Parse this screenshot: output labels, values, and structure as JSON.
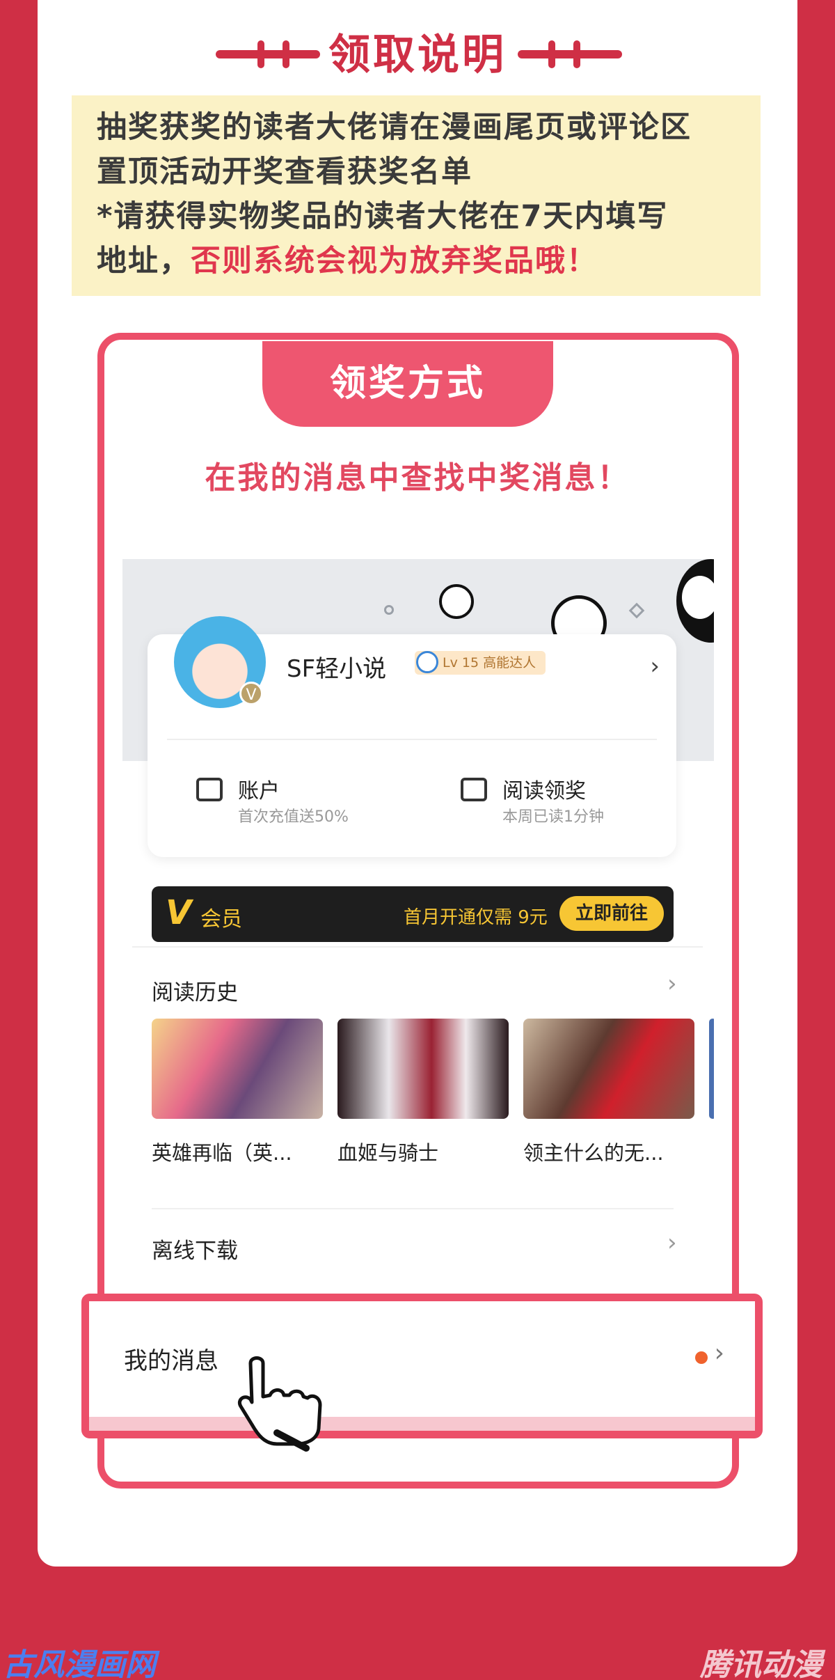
{
  "header": {
    "title": "领取说明"
  },
  "notice": {
    "line1": "抽奖获奖的读者大佬请在漫画尾页或评论区",
    "line2": "置顶活动开奖查看获奖名单",
    "line3": "*请获得实物奖品的读者大佬在7天内填写",
    "line4_plain": "地址，",
    "line4_red": "否则系统会视为放弃奖品哦！"
  },
  "claim": {
    "tab_label": "领奖方式",
    "subtitle": "在我的消息中查找中奖消息！"
  },
  "app": {
    "profile": {
      "username": "SF轻小说",
      "level_badge": "Lv 15 高能达人",
      "verified_mark": "V",
      "account_label": "账户",
      "account_sub": "首次充值送50%",
      "reading_label": "阅读领奖",
      "reading_sub": "本周已读1分钟"
    },
    "vip": {
      "v_letter": "V",
      "title": "会员",
      "promo": "首月开通仅需 9元",
      "button": "立即前往"
    },
    "history": {
      "title": "阅读历史",
      "items": [
        {
          "caption": "英雄再临（英..."
        },
        {
          "caption": "血姬与骑士"
        },
        {
          "caption": "领主什么的无..."
        }
      ]
    },
    "offline": {
      "title": "离线下载"
    },
    "messages": {
      "title": "我的消息"
    }
  },
  "watermarks": {
    "left": "古风漫画网",
    "right": "腾讯动漫"
  },
  "colors": {
    "brand_red": "#cf2f45",
    "accent_pink": "#ec4f69",
    "vip_gold": "#f7c634"
  }
}
